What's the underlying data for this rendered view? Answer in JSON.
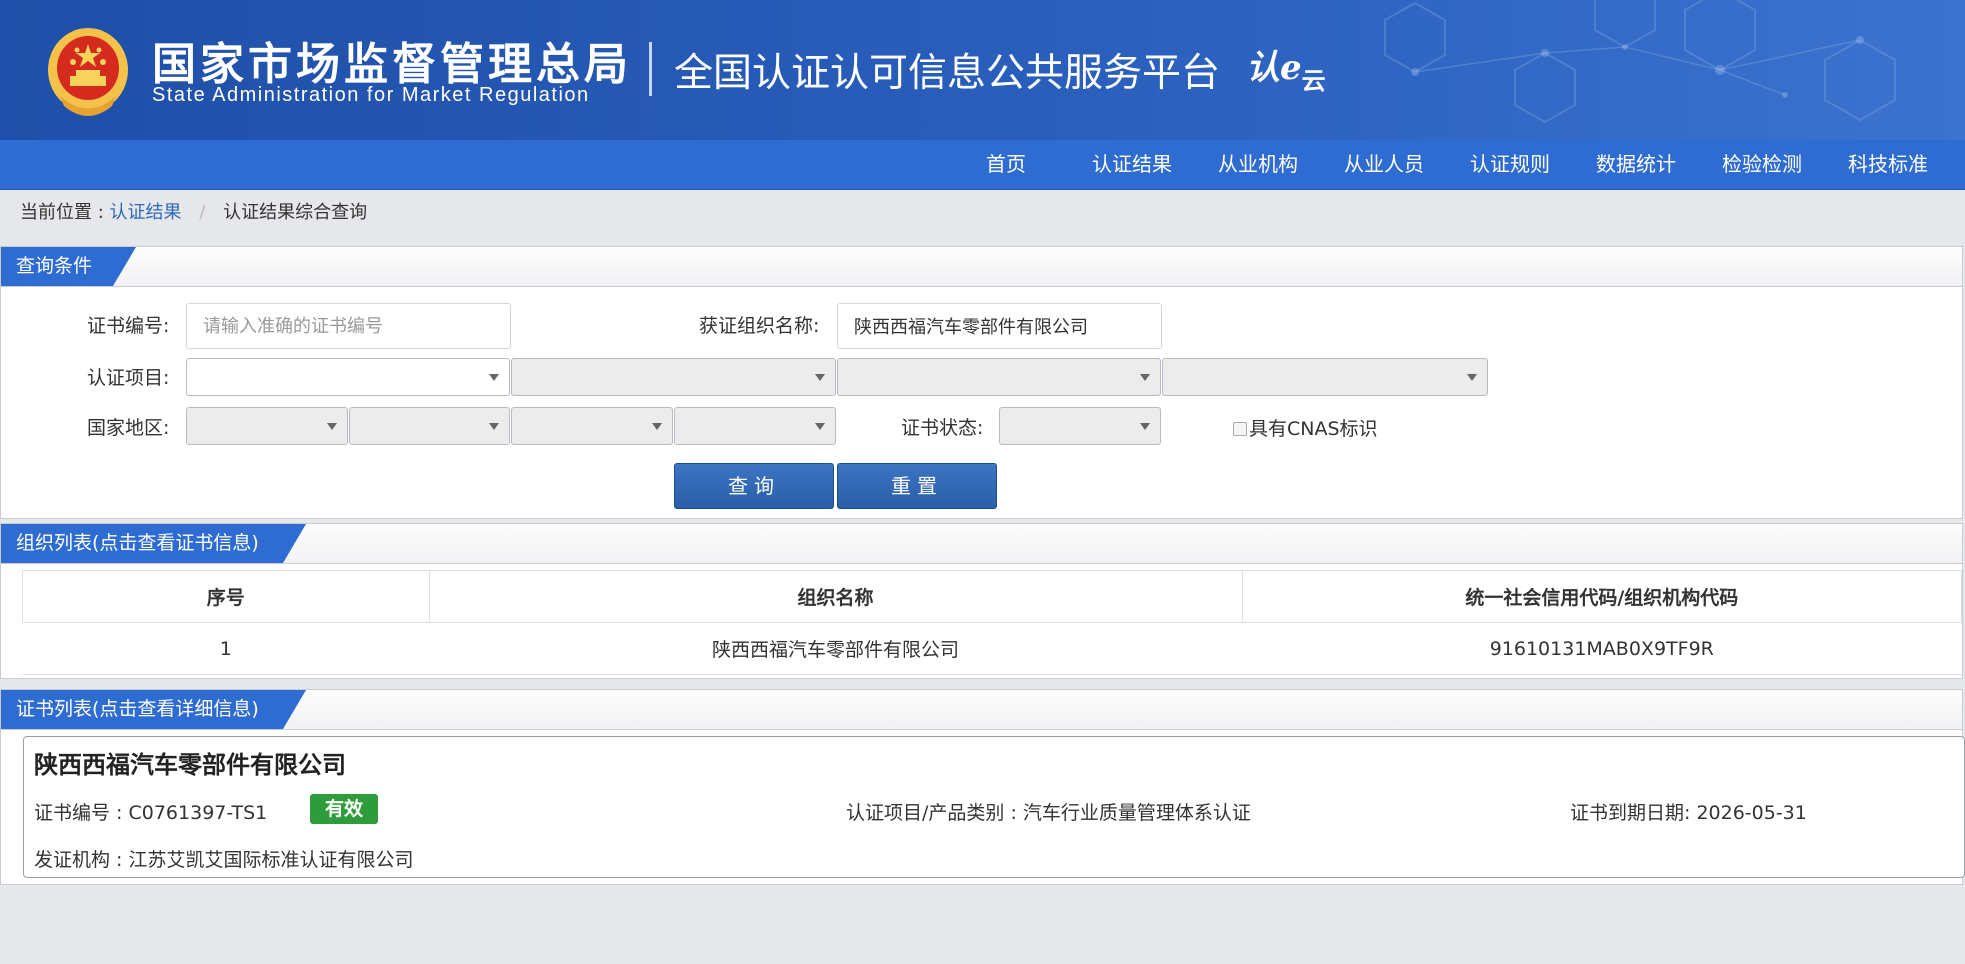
{
  "header": {
    "org_name_cn": "国家市场监督管理总局",
    "org_name_en": "State Administration  for  Market Regulation",
    "platform_name": "全国认证认可信息公共服务平台",
    "logo_text": "认e",
    "logo_text_small": "云",
    "brand_color": "#2a5fbc",
    "nav_color": "#2e6cd1"
  },
  "nav": {
    "items": [
      {
        "label": "首页"
      },
      {
        "label": "认证结果"
      },
      {
        "label": "从业机构"
      },
      {
        "label": "从业人员"
      },
      {
        "label": "认证规则"
      },
      {
        "label": "数据统计"
      },
      {
        "label": "检验检测"
      },
      {
        "label": "科技标准"
      }
    ]
  },
  "breadcrumb": {
    "prefix": "当前位置 :",
    "link": "认证结果",
    "separator": "/",
    "current": "认证结果综合查询"
  },
  "query": {
    "title": "查询条件",
    "cert_no_label": "证书编号:",
    "cert_no_value": "",
    "cert_no_placeholder": "请输入准确的证书编号",
    "org_label": "获证组织名称:",
    "org_value": "陕西西福汽车零部件有限公司",
    "project_label": "认证项目:",
    "region_label": "国家地区:",
    "status_label": "证书状态:",
    "cnas_label": "具有CNAS标识",
    "cnas_checked": false,
    "search_button": "查询",
    "reset_button": "重置"
  },
  "org_list": {
    "title": "组织列表(点击查看证书信息)",
    "columns": [
      "序号",
      "组织名称",
      "统一社会信用代码/组织机构代码"
    ],
    "rows": [
      [
        "1",
        "陕西西福汽车零部件有限公司",
        "91610131MAB0X9TF9R"
      ]
    ]
  },
  "cert_list": {
    "title": "证书列表(点击查看详细信息)",
    "items": [
      {
        "org_name": "陕西西福汽车零部件有限公司",
        "cert_no": "证书编号 : C0761397-TS1",
        "status": "有效",
        "status_color": "#2e9c3a",
        "project": "认证项目/产品类别 : 汽车行业质量管理体系认证",
        "expiry": "证书到期日期: 2026-05-31",
        "issuer": "发证机构 : 江苏艾凯艾国际标准认证有限公司"
      }
    ]
  }
}
